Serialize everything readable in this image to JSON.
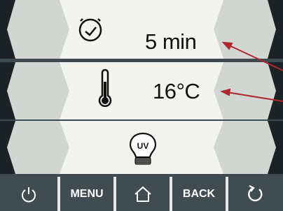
{
  "rows": [
    {
      "icon": "clock-icon",
      "value": "5 min"
    },
    {
      "icon": "thermometer-icon",
      "value": "16°C"
    },
    {
      "icon": "uv-lamp-icon",
      "value": ""
    }
  ],
  "uv_icon_text": "UV",
  "toolbar": {
    "power_icon": "power-icon",
    "menu_label": "MENU",
    "home_icon": "home-icon",
    "back_label": "BACK",
    "refresh_icon": "refresh-icon"
  },
  "colors": {
    "band": "#f3f4ef",
    "side_button": "#d2d6d2",
    "side_edge": "#1c2326",
    "toolbar": "#3f4d52",
    "separator": "#e6e8e6",
    "arrow": "#b0272e"
  }
}
